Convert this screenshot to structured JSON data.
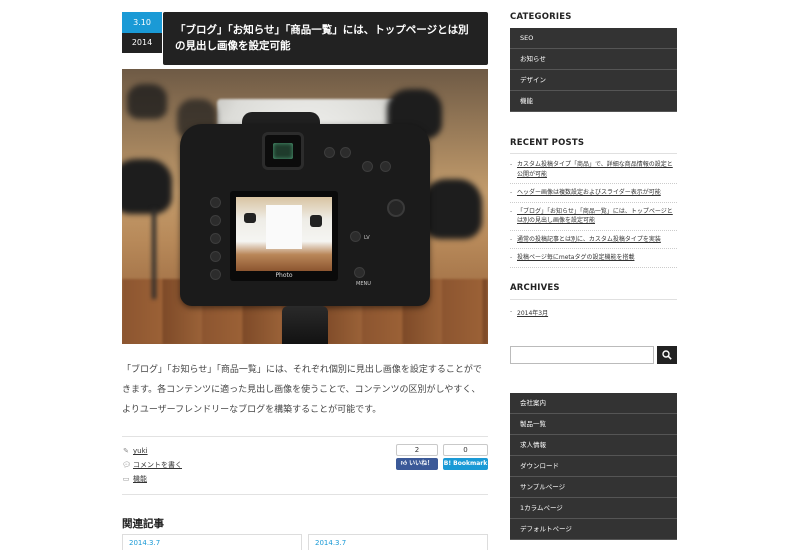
{
  "post": {
    "date_md": "3.10",
    "date_year": "2014",
    "title": "「ブログ」「お知らせ」「商品一覧」には、トップページとは別の見出し画像を設定可能",
    "image_screen_label": "Photo",
    "image_camera_labels": [
      "LV",
      "MENU"
    ],
    "body": "「ブログ」「お知らせ」「商品一覧」には、それぞれ個別に見出し画像を設定することができます。各コンテンツに適った見出し画像を使うことで、コンテンツの区別がしやすく、よりユーザーフレンドリーなブログを構築することが可能です。",
    "author": "yuki",
    "comment_link": "コメントを書く",
    "category": "機能"
  },
  "share": {
    "like_count": "2",
    "like_label": "いいね！",
    "bookmark_count": "0",
    "bookmark_label": "B! Bookmark",
    "like_color": "#3b5998",
    "bookmark_color": "#1a9ad6"
  },
  "related": {
    "heading": "関連記事",
    "items": [
      {
        "date": "2014.3.7"
      },
      {
        "date": "2014.3.7"
      }
    ]
  },
  "sidebar": {
    "categories_heading": "CATEGORIES",
    "categories": [
      "SEO",
      "お知らせ",
      "デザイン",
      "機能"
    ],
    "recent_heading": "RECENT POSTS",
    "recent": [
      "カスタム投稿タイプ「商品」で、詳細な商品情報の設定と公開が可能",
      "ヘッダー画像は複数設定およびスライダー表示が可能",
      "「ブログ」「お知らせ」「商品一覧」には、トップページとは別の見出し画像を設定可能",
      "通常の投稿記事とは別に、カスタム投稿タイプを実装",
      "投稿ページ毎にmetaタグの設定機能を搭載"
    ],
    "archives_heading": "ARCHIVES",
    "archives": [
      "2014年3月"
    ],
    "search_value": "",
    "pages": [
      "会社案内",
      "製品一覧",
      "求人情報",
      "ダウンロード",
      "サンプルページ",
      "1カラムページ",
      "デフォルトページ"
    ]
  },
  "colors": {
    "accent": "#1a9ad6",
    "dark": "#222222",
    "sidebar_item": "#333333"
  },
  "icons": {
    "author": "pencil-icon",
    "comment": "speech-bubble-icon",
    "category": "folder-icon",
    "search": "magnifier-icon"
  }
}
